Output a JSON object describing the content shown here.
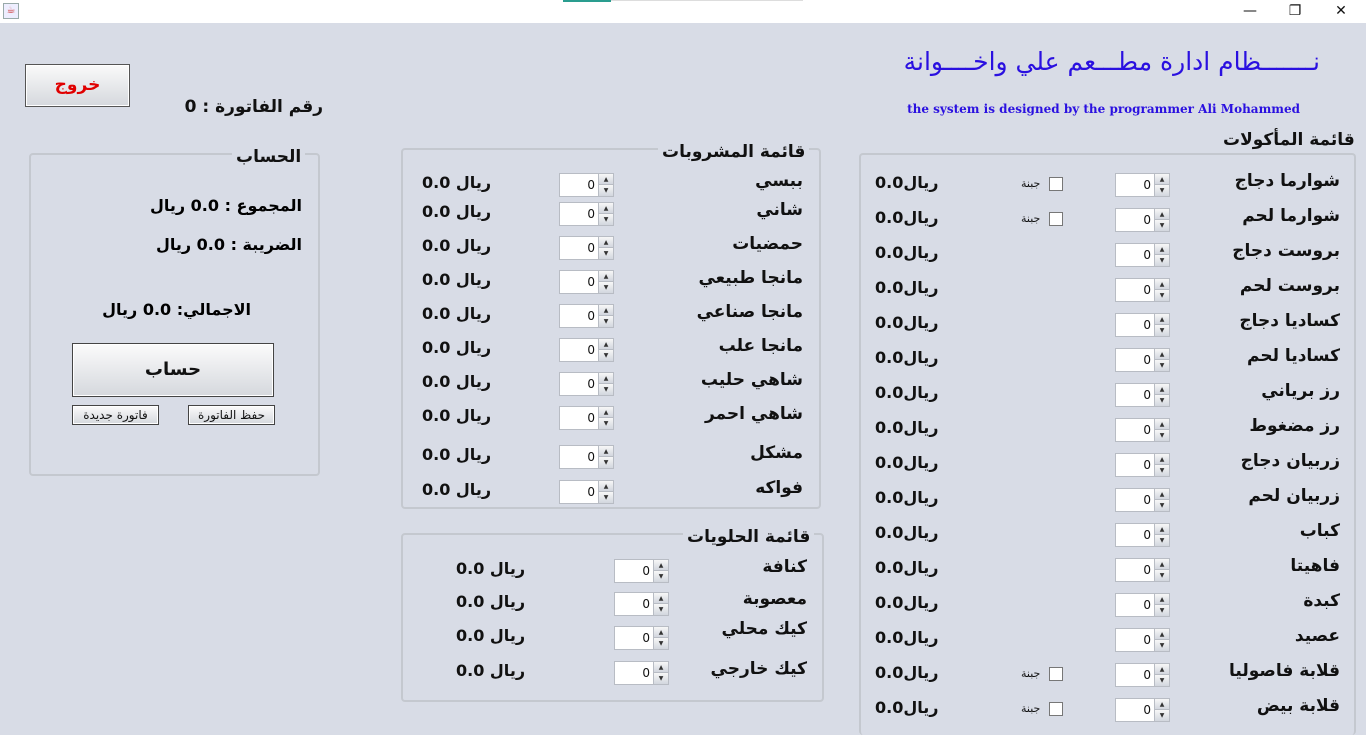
{
  "window": {
    "minimize": "—",
    "maximize": "❐",
    "close": "✕"
  },
  "header": {
    "title": "نـــــــظام ادارة مطـــعم علي واخــــوانة",
    "subtitle": "the system is designed by the programmer Ali Mohammed"
  },
  "exit_label": "خروج",
  "invoice_label": "رقم الفاتورة : 0",
  "account": {
    "title": "الحساب",
    "total": "المجموع : 0.0 ريال",
    "tax": "الضريبة : 0.0 ريال",
    "grand": "الاجمالي: 0.0 ريال",
    "calc_btn": "حساب",
    "new_btn": "فاتورة جديدة",
    "save_btn": "حفظ الفاتورة"
  },
  "food": {
    "title": "قائمة المأكولات",
    "items": [
      {
        "name": "شوارما دجاج",
        "qty": "0",
        "price": "0.0ريال",
        "cheese": "جبنة"
      },
      {
        "name": "شوارما لحم",
        "qty": "0",
        "price": "0.0ريال",
        "cheese": "جبنة"
      },
      {
        "name": "بروست دجاج",
        "qty": "0",
        "price": "0.0ريال"
      },
      {
        "name": "بروست لحم",
        "qty": "0",
        "price": "0.0ريال"
      },
      {
        "name": "كساديا دجاج",
        "qty": "0",
        "price": "0.0ريال"
      },
      {
        "name": "كساديا لحم",
        "qty": "0",
        "price": "0.0ريال"
      },
      {
        "name": "رز برياني",
        "qty": "0",
        "price": "0.0ريال"
      },
      {
        "name": "رز مضغوط",
        "qty": "0",
        "price": "0.0ريال"
      },
      {
        "name": "زربيان دجاج",
        "qty": "0",
        "price": "0.0ريال"
      },
      {
        "name": "زربيان لحم",
        "qty": "0",
        "price": "0.0ريال"
      },
      {
        "name": "كباب",
        "qty": "0",
        "price": "0.0ريال"
      },
      {
        "name": "فاهيتا",
        "qty": "0",
        "price": "0.0ريال"
      },
      {
        "name": "كبدة",
        "qty": "0",
        "price": "0.0ريال"
      },
      {
        "name": "عصيد",
        "qty": "0",
        "price": "0.0ريال"
      },
      {
        "name": "قلابة فاصوليا",
        "qty": "0",
        "price": "0.0ريال",
        "cheese": "جبنة"
      },
      {
        "name": "قلابة بيض",
        "qty": "0",
        "price": "0.0ريال",
        "cheese": "جبنة"
      }
    ]
  },
  "drinks": {
    "title": "قائمة المشروبات",
    "items": [
      {
        "name": "ببسي",
        "qty": "0",
        "price": "0.0 ريال"
      },
      {
        "name": "شاني",
        "qty": "0",
        "price": "0.0 ريال"
      },
      {
        "name": "حمضيات",
        "qty": "0",
        "price": "0.0 ريال"
      },
      {
        "name": "مانجا طبيعي",
        "qty": "0",
        "price": "0.0 ريال"
      },
      {
        "name": "مانجا صناعي",
        "qty": "0",
        "price": "0.0 ريال"
      },
      {
        "name": "مانجا علب",
        "qty": "0",
        "price": "0.0 ريال"
      },
      {
        "name": "شاهي حليب",
        "qty": "0",
        "price": "0.0 ريال"
      },
      {
        "name": "شاهي احمر",
        "qty": "0",
        "price": "0.0 ريال"
      },
      {
        "name": "مشكل",
        "qty": "0",
        "price": "0.0 ريال"
      },
      {
        "name": "فواكه",
        "qty": "0",
        "price": "0.0 ريال"
      }
    ]
  },
  "sweets": {
    "title": "قائمة الحلويات",
    "items": [
      {
        "name": "كنافة",
        "qty": "0",
        "price": "0.0 ريال"
      },
      {
        "name": "معصوبة",
        "qty": "0",
        "price": "0.0 ريال"
      },
      {
        "name": "كيك محلي",
        "qty": "0",
        "price": "0.0 ريال"
      },
      {
        "name": "كيك خارجي",
        "qty": "0",
        "price": "0.0 ريال"
      }
    ]
  },
  "colors": {
    "title": "#2a10e0",
    "exit": "#e00000",
    "bg": "#d8dce6"
  }
}
